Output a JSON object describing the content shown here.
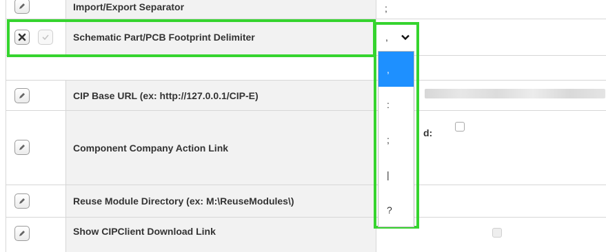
{
  "rows": {
    "import_export": {
      "label": "Import/Export Separator",
      "value": ";"
    },
    "delimiter": {
      "label": "Schematic Part/PCB Footprint Delimiter",
      "selected_value": ","
    },
    "cip_base": {
      "label": "CIP Base URL (ex: http://127.0.0.1/CIP-E)"
    },
    "action_link": {
      "label": "Component Company Action Link",
      "enabled_label": "d:"
    },
    "reuse_dir": {
      "label": "Reuse Module Directory (ex: M:\\ReuseModules\\)"
    },
    "download": {
      "label": "Show CIPClient Download Link"
    }
  },
  "dropdown": {
    "options": [
      ",",
      ":",
      ";",
      "|",
      "?"
    ],
    "selected": ","
  },
  "colors": {
    "highlight": "#35d42e",
    "selected_option": "#1e90ff",
    "label_bg": "#f2f2f2"
  },
  "icons": {
    "edit": "pencil-icon",
    "cancel": "x-icon",
    "confirm": "check-icon",
    "dropdown": "chevron-down-icon"
  }
}
